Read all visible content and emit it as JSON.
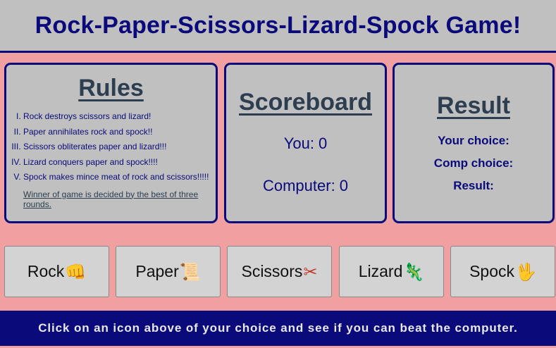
{
  "header": {
    "title": "Rock-Paper-Scissors-Lizard-Spock Game!"
  },
  "rules": {
    "title": "Rules",
    "items": [
      "Rock destroys scissors and lizard!",
      "Paper annihilates rock and spock!!",
      "Scissors obliterates paper and lizard!!!",
      "Lizard conquers paper and spock!!!!",
      "Spock makes mince meat of rock and scissors!!!!!"
    ],
    "note": "Winner of game is decided by the best of three rounds."
  },
  "scoreboard": {
    "title": "Scoreboard",
    "you": "You: 0",
    "computer": "Computer: 0"
  },
  "result": {
    "title": "Result",
    "your_choice": "Your choice:",
    "comp_choice": "Comp choice:",
    "result": "Result:"
  },
  "choices": [
    {
      "label": "Rock",
      "icon": "fist-icon",
      "glyph": "👊"
    },
    {
      "label": "Paper",
      "icon": "scroll-icon",
      "glyph": "📜"
    },
    {
      "label": "Scissors",
      "icon": "scissors-icon",
      "glyph": "✂"
    },
    {
      "label": "Lizard",
      "icon": "lizard-icon",
      "glyph": "🦎"
    },
    {
      "label": "Spock",
      "icon": "vulcan-salute-icon",
      "glyph": "🖖"
    }
  ],
  "footer": {
    "text": "Click on an icon above of your choice and see if you can beat the computer."
  },
  "colors": {
    "navy": "#0a0a7a",
    "panel_bg": "#c0c0c0",
    "page_bg": "#f0a0a0",
    "heading": "#2c3e50"
  }
}
